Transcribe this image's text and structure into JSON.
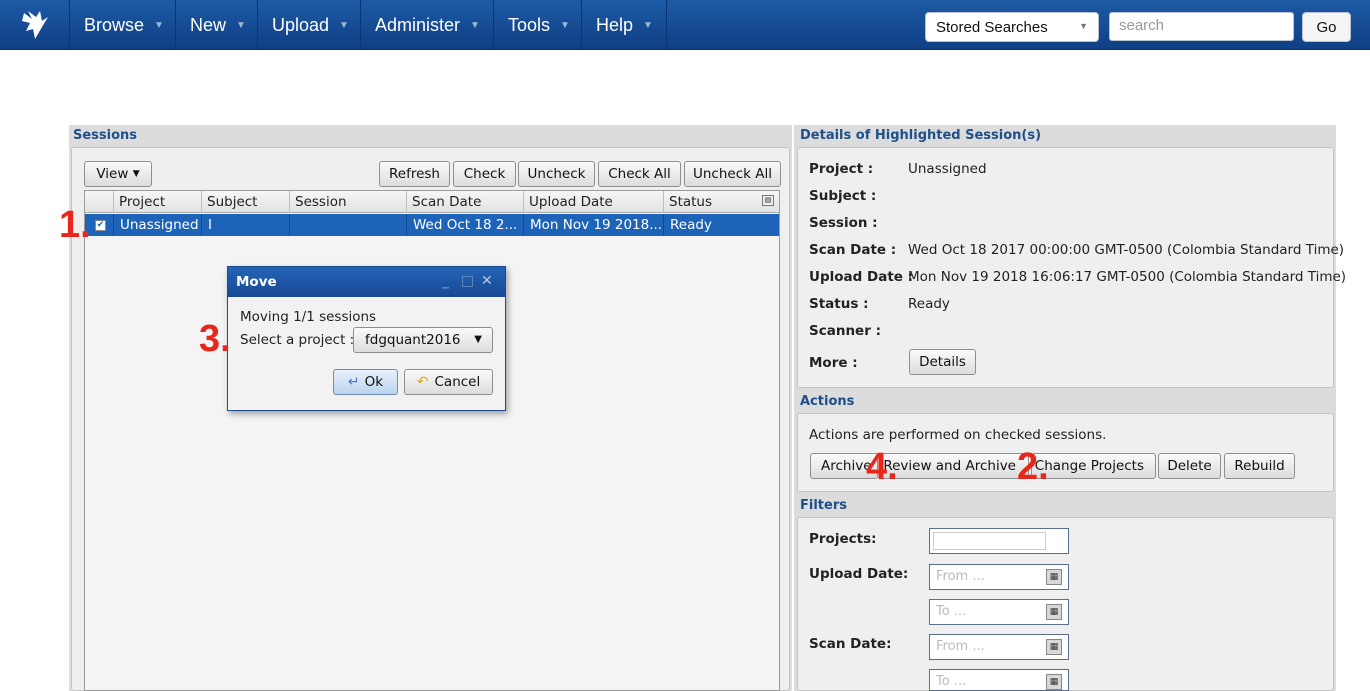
{
  "nav": {
    "items": [
      "Browse",
      "New",
      "Upload",
      "Administer",
      "Tools",
      "Help"
    ],
    "stored_searches": "Stored Searches",
    "search_placeholder": "search",
    "go_label": "Go"
  },
  "sessions": {
    "title": "Sessions",
    "view_label": "View",
    "buttons": [
      "Refresh",
      "Check",
      "Uncheck",
      "Check All",
      "Uncheck All"
    ],
    "columns": [
      "Project",
      "Subject",
      "Session",
      "Scan Date",
      "Upload Date",
      "Status"
    ],
    "rows": [
      {
        "checked": true,
        "project": "Unassigned",
        "subject": "I",
        "session": "",
        "scan_date": "Wed Oct 18 2...",
        "upload_date": "Mon Nov 19 2018...",
        "status": "Ready"
      }
    ]
  },
  "dialog": {
    "title": "Move",
    "message": "Moving 1/1 sessions",
    "select_label": "Select a project :",
    "selected_project": "fdgquant2016",
    "ok_label": "Ok",
    "cancel_label": "Cancel"
  },
  "details": {
    "title": "Details of Highlighted Session(s)",
    "fields": [
      {
        "label": "Project :",
        "value": "Unassigned"
      },
      {
        "label": "Subject :",
        "value": ""
      },
      {
        "label": "Session :",
        "value": ""
      },
      {
        "label": "Scan Date :",
        "value": "Wed Oct 18 2017 00:00:00 GMT-0500 (Colombia Standard Time)"
      },
      {
        "label": "Upload Date :",
        "value": "Mon Nov 19 2018 16:06:17 GMT-0500 (Colombia Standard Time)"
      },
      {
        "label": "Status :",
        "value": "Ready"
      },
      {
        "label": "Scanner :",
        "value": ""
      }
    ],
    "more_label": "More :",
    "details_button": "Details"
  },
  "actions": {
    "title": "Actions",
    "note": "Actions are performed on checked sessions.",
    "buttons": [
      "Archive",
      "Review and Archive",
      "Change Projects",
      "Delete",
      "Rebuild"
    ]
  },
  "filters": {
    "title": "Filters",
    "projects_label": "Projects:",
    "upload_date_label": "Upload Date:",
    "scan_date_label": "Scan Date:",
    "from_placeholder": "From ...",
    "to_placeholder": "To ..."
  },
  "annotations": [
    "1.",
    "2.",
    "3.",
    "4."
  ],
  "colors": {
    "navbar": "#1a55a0",
    "selection": "#1d64b8",
    "annotation": "#e8261b",
    "panel_title": "#1f4f8a"
  }
}
